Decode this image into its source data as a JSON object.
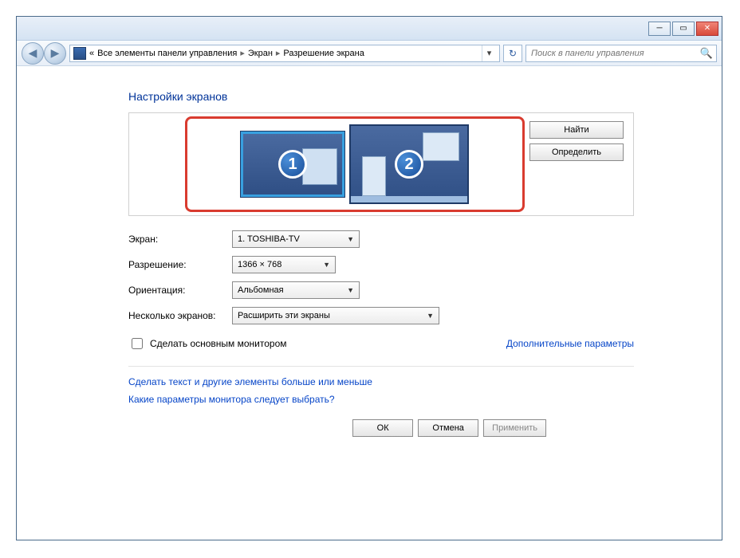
{
  "titlebar": {
    "min": "─",
    "max": "▭",
    "close": "✕"
  },
  "nav": {
    "back": "◀",
    "fwd": "▶"
  },
  "breadcrumb": {
    "lead": "«",
    "item1": "Все элементы панели управления",
    "item2": "Экран",
    "item3": "Разрешение экрана"
  },
  "search": {
    "placeholder": "Поиск в панели управления"
  },
  "heading": "Настройки экранов",
  "monitors": {
    "m1": "1",
    "m2": "2"
  },
  "side": {
    "find": "Найти",
    "detect": "Определить"
  },
  "form": {
    "screen_label": "Экран:",
    "screen_value": "1. TOSHIBA-TV",
    "res_label": "Разрешение:",
    "res_value": "1366 × 768",
    "orient_label": "Ориентация:",
    "orient_value": "Альбомная",
    "multi_label": "Несколько экранов:",
    "multi_value": "Расширить эти экраны"
  },
  "checkbox": {
    "label": "Сделать основным монитором"
  },
  "links": {
    "advanced": "Дополнительные параметры",
    "textsize": "Сделать текст и другие элементы больше или меньше",
    "which": "Какие параметры монитора следует выбрать?"
  },
  "footer": {
    "ok": "ОК",
    "cancel": "Отмена",
    "apply": "Применить"
  }
}
